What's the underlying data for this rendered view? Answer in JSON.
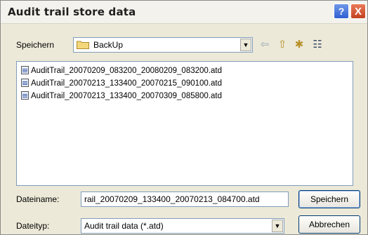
{
  "window": {
    "title": "Audit trail store data",
    "help": "?",
    "close": "X"
  },
  "save_in": {
    "label": "Speichern",
    "value": "BackUp"
  },
  "toolbar": {
    "back_glyph": "⇦",
    "up_glyph": "⇧",
    "newfolder_glyph": "✱",
    "view_glyph": "☷"
  },
  "files": [
    "AuditTrail_20070209_083200_20080209_083200.atd",
    "AuditTrail_20070213_133400_20070215_090100.atd",
    "AuditTrail_20070213_133400_20070309_085800.atd"
  ],
  "filename": {
    "label": "Dateiname:",
    "value": "rail_20070209_133400_20070213_084700.atd"
  },
  "filetype": {
    "label": "Dateityp:",
    "value": "Audit trail data (*.atd)"
  },
  "buttons": {
    "save": "Speichern",
    "cancel": "Abbrechen"
  }
}
